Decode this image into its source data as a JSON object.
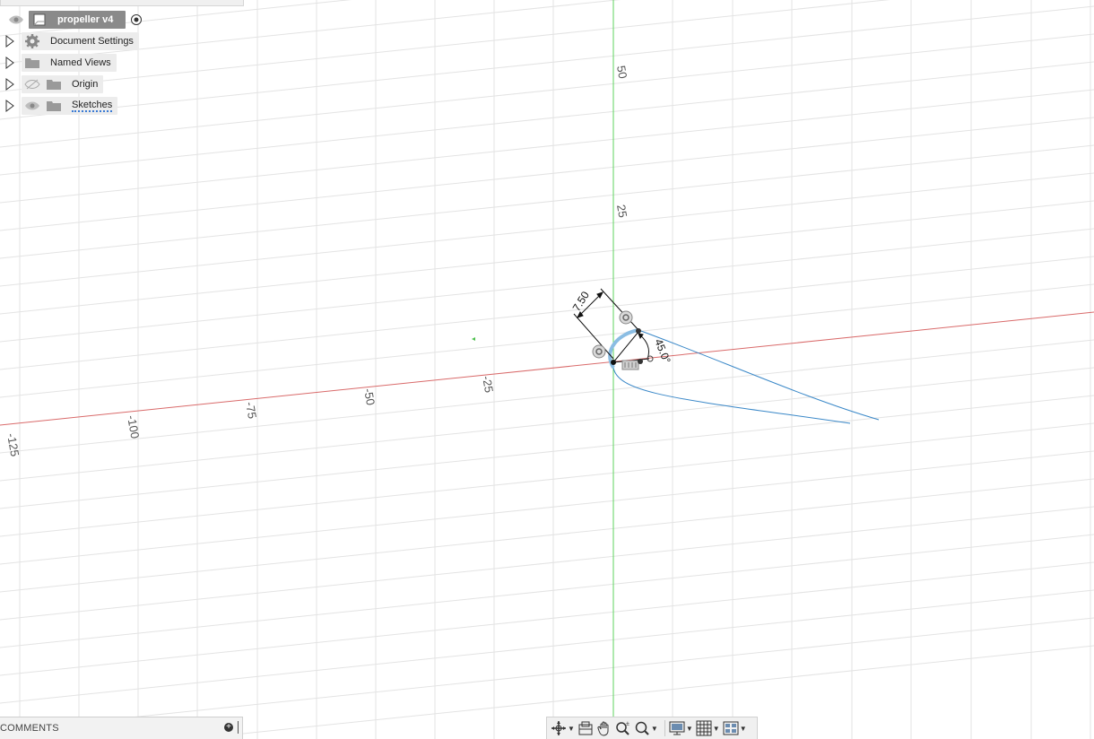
{
  "browser": {
    "root": {
      "label": "propeller v4"
    },
    "items": [
      {
        "label": "Document Settings"
      },
      {
        "label": "Named Views"
      },
      {
        "label": "Origin"
      },
      {
        "label": "Sketches"
      }
    ]
  },
  "canvas": {
    "axis_colors": {
      "x_axis": "#d9534f",
      "y_axis": "#4cd964",
      "grid": "#e3e3e3",
      "sketch": "#3a88c8"
    },
    "x_tick_labels": [
      "-125",
      "-100",
      "-75",
      "-50",
      "-25"
    ],
    "y_tick_labels": [
      "50",
      "25"
    ],
    "dimensions": {
      "length": "7.50",
      "angle": "45.0°"
    }
  },
  "comments": {
    "label": "COMMENTS"
  },
  "nav_toolbar": {
    "tools": [
      "orbit-icon",
      "look-at-icon",
      "pan-icon",
      "zoom-icon",
      "zoom-window-icon",
      "display-settings-icon",
      "grid-settings-icon",
      "viewports-icon"
    ]
  }
}
